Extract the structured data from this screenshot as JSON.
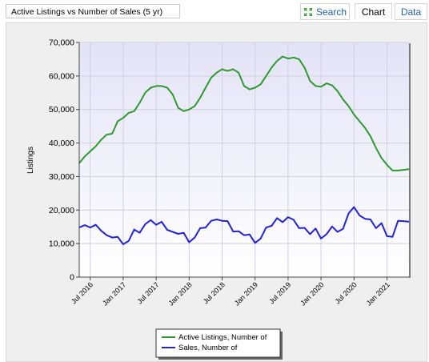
{
  "header": {
    "title_input_value": "Active Listings vs Number of Sales (5 yr)",
    "tabs": [
      {
        "label": "Search",
        "icon": "expand-arrows-icon"
      },
      {
        "label": "Chart"
      },
      {
        "label": "Data"
      }
    ],
    "active_tab": "Chart"
  },
  "chart_data": {
    "type": "line",
    "ylabel": "Listings",
    "xlabel": "",
    "ylim": [
      0,
      70000
    ],
    "yticks": [
      0,
      10000,
      20000,
      30000,
      40000,
      50000,
      60000,
      70000
    ],
    "ytick_labels": [
      "0",
      "10,000",
      "20,000",
      "30,000",
      "40,000",
      "50,000",
      "60,000",
      "70,000"
    ],
    "x_tick_labels": [
      "Jul 2016",
      "Jan 2017",
      "Jul 2017",
      "Jan 2018",
      "Jul 2018",
      "Jan 2019",
      "Jul 2019",
      "Jan 2020",
      "Jul 2020",
      "Jan 2021"
    ],
    "x_start": "2016-05",
    "x_end": "2021-05",
    "grid": true,
    "legend_position": "bottom-center",
    "series": [
      {
        "name": "Active Listings, Number of",
        "color": "#2e9a2e",
        "values": [
          34000,
          36000,
          37500,
          39000,
          41000,
          42500,
          42800,
          46500,
          47500,
          49000,
          49500,
          52000,
          55000,
          56500,
          57000,
          57000,
          56500,
          54500,
          50500,
          49500,
          50000,
          51000,
          53500,
          56500,
          59500,
          61000,
          62000,
          61500,
          62000,
          61000,
          57000,
          56000,
          56500,
          57500,
          60000,
          62500,
          64500,
          65800,
          65200,
          65500,
          65000,
          62500,
          58500,
          57000,
          56800,
          57800,
          57200,
          55500,
          53000,
          51000,
          48500,
          46500,
          44500,
          42000,
          38500,
          35500,
          33500,
          31800,
          31800,
          32000,
          32200
        ]
      },
      {
        "name": "Sales, Number of",
        "color": "#2222dd",
        "values": [
          14800,
          15500,
          14800,
          15600,
          13800,
          12500,
          11800,
          12000,
          9800,
          10800,
          14200,
          13200,
          15800,
          17000,
          15600,
          16500,
          14100,
          13500,
          12900,
          13200,
          10400,
          11800,
          14600,
          14800,
          16800,
          17200,
          16800,
          16700,
          13600,
          13700,
          12500,
          12700,
          10200,
          11500,
          14800,
          15300,
          17600,
          16400,
          17900,
          17100,
          14600,
          14700,
          12800,
          14500,
          11500,
          12800,
          15100,
          13500,
          14400,
          19000,
          20900,
          18400,
          17400,
          17200,
          14600,
          16100,
          12200,
          12000,
          16800,
          16700,
          16500
        ]
      }
    ]
  }
}
